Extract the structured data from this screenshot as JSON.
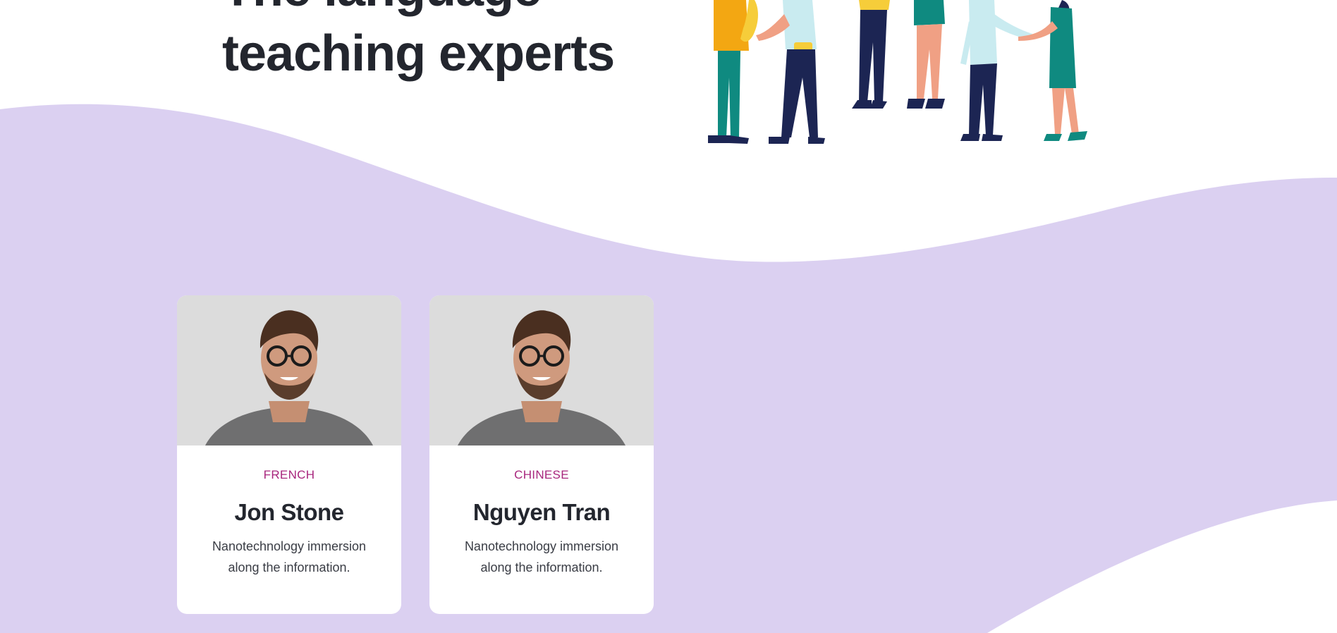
{
  "hero": {
    "title_line1": "The language",
    "title_line2": "teaching experts"
  },
  "colors": {
    "lavender": "#dbd0f1",
    "accent": "#a8267d",
    "heading": "#23262e"
  },
  "teachers": [
    {
      "language": "FRENCH",
      "name": "Jon Stone",
      "description": "Nanotechnology immersion along the information."
    },
    {
      "language": "CHINESE",
      "name": "Nguyen Tran",
      "description": "Nanotechnology immersion along the information."
    }
  ],
  "icons": {
    "illustration": "people-meeting-illustration",
    "photo": "teacher-portrait"
  }
}
